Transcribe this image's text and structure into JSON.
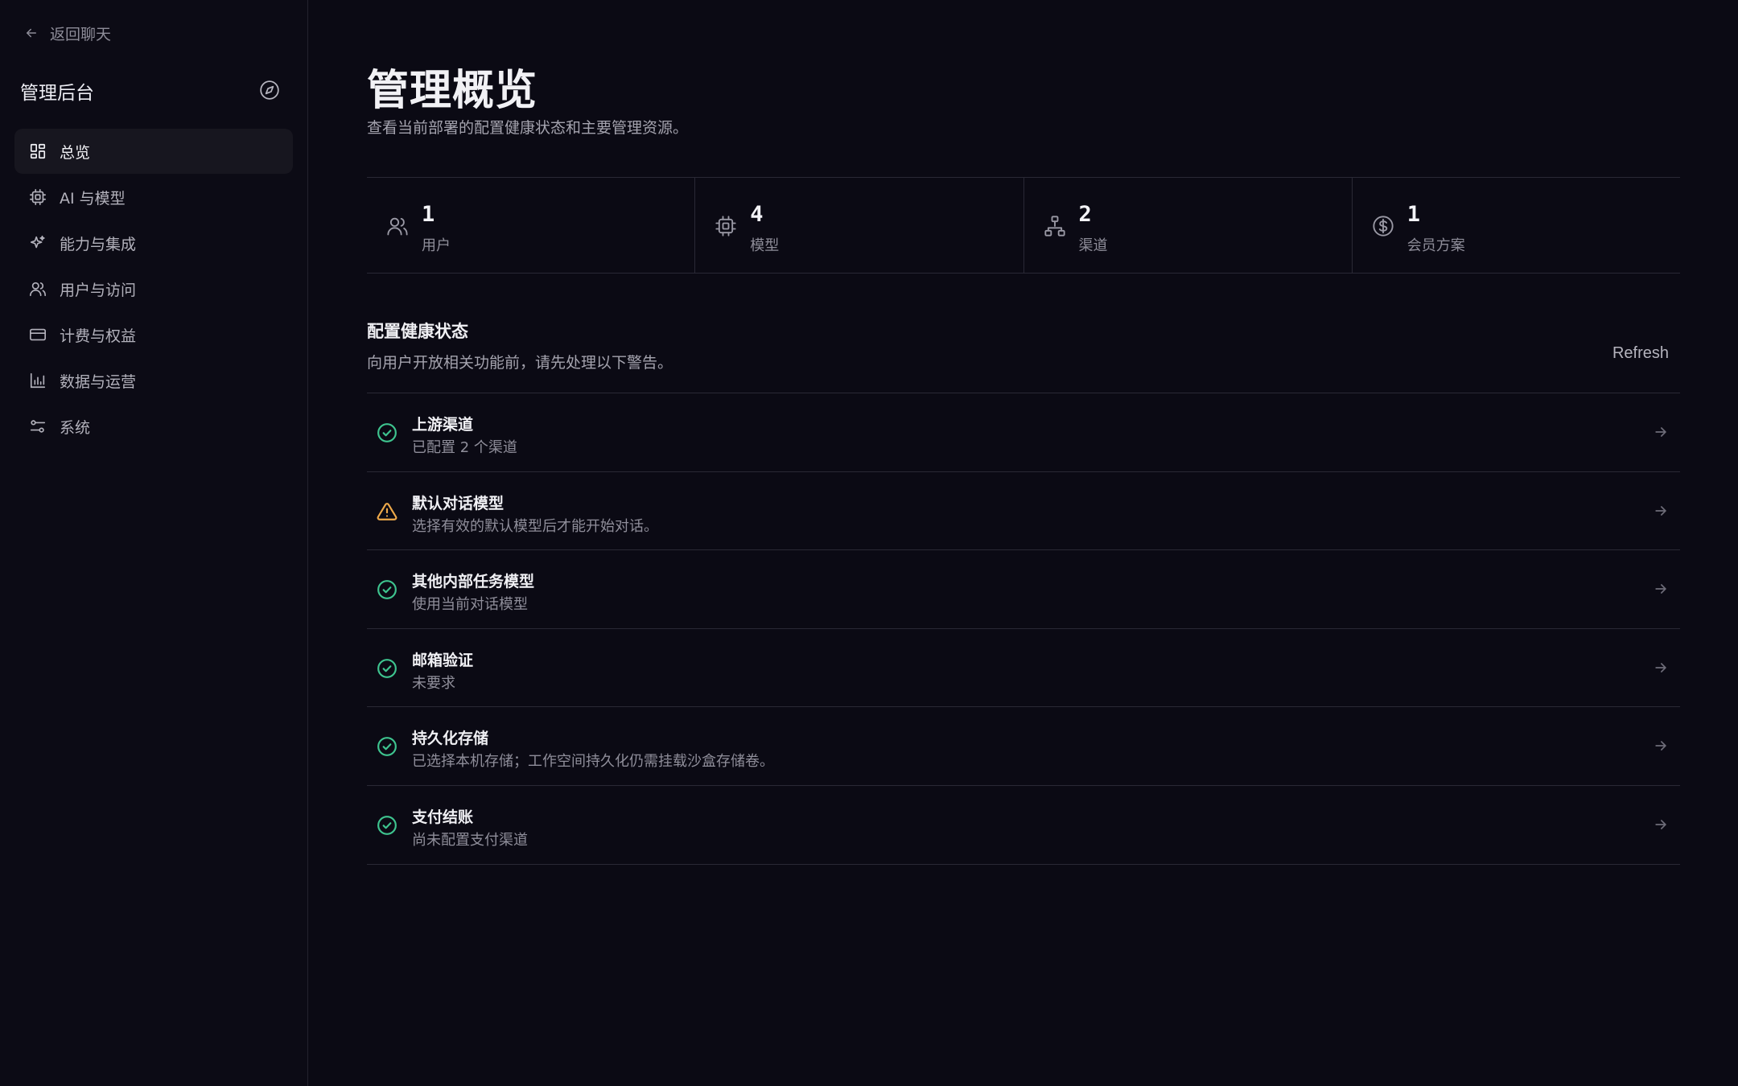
{
  "sidebar": {
    "back_label": "返回聊天",
    "title": "管理后台",
    "items": [
      {
        "label": "总览",
        "icon": "dashboard-icon",
        "active": true
      },
      {
        "label": "AI 与模型",
        "icon": "cpu-chip-icon"
      },
      {
        "label": "能力与集成",
        "icon": "sparkles-icon"
      },
      {
        "label": "用户与访问",
        "icon": "users-icon"
      },
      {
        "label": "计费与权益",
        "icon": "credit-card-icon"
      },
      {
        "label": "数据与运营",
        "icon": "bar-chart-icon"
      },
      {
        "label": "系统",
        "icon": "sliders-icon"
      }
    ]
  },
  "main": {
    "title": "管理概览",
    "subtitle": "查看当前部署的配置健康状态和主要管理资源。",
    "stats": [
      {
        "value": "1",
        "label": "用户",
        "icon": "users-icon"
      },
      {
        "value": "4",
        "label": "模型",
        "icon": "cpu-chip-icon"
      },
      {
        "value": "2",
        "label": "渠道",
        "icon": "network-icon"
      },
      {
        "value": "1",
        "label": "会员方案",
        "icon": "dollar-circle-icon"
      }
    ],
    "health": {
      "title": "配置健康状态",
      "subtitle": "向用户开放相关功能前，请先处理以下警告。",
      "refresh_label": "Refresh",
      "checks": [
        {
          "title": "上游渠道",
          "desc": "已配置 2 个渠道",
          "status": "ok"
        },
        {
          "title": "默认对话模型",
          "desc": "选择有效的默认模型后才能开始对话。",
          "status": "warning"
        },
        {
          "title": "其他内部任务模型",
          "desc": "使用当前对话模型",
          "status": "ok"
        },
        {
          "title": "邮箱验证",
          "desc": "未要求",
          "status": "ok"
        },
        {
          "title": "持久化存储",
          "desc": "已选择本机存储；工作空间持久化仍需挂载沙盒存储卷。",
          "status": "ok"
        },
        {
          "title": "支付结账",
          "desc": "尚未配置支付渠道",
          "status": "ok"
        }
      ]
    }
  },
  "colors": {
    "background": "#0b0a14",
    "ok": "#3ec48f",
    "warning": "#eea94a"
  }
}
